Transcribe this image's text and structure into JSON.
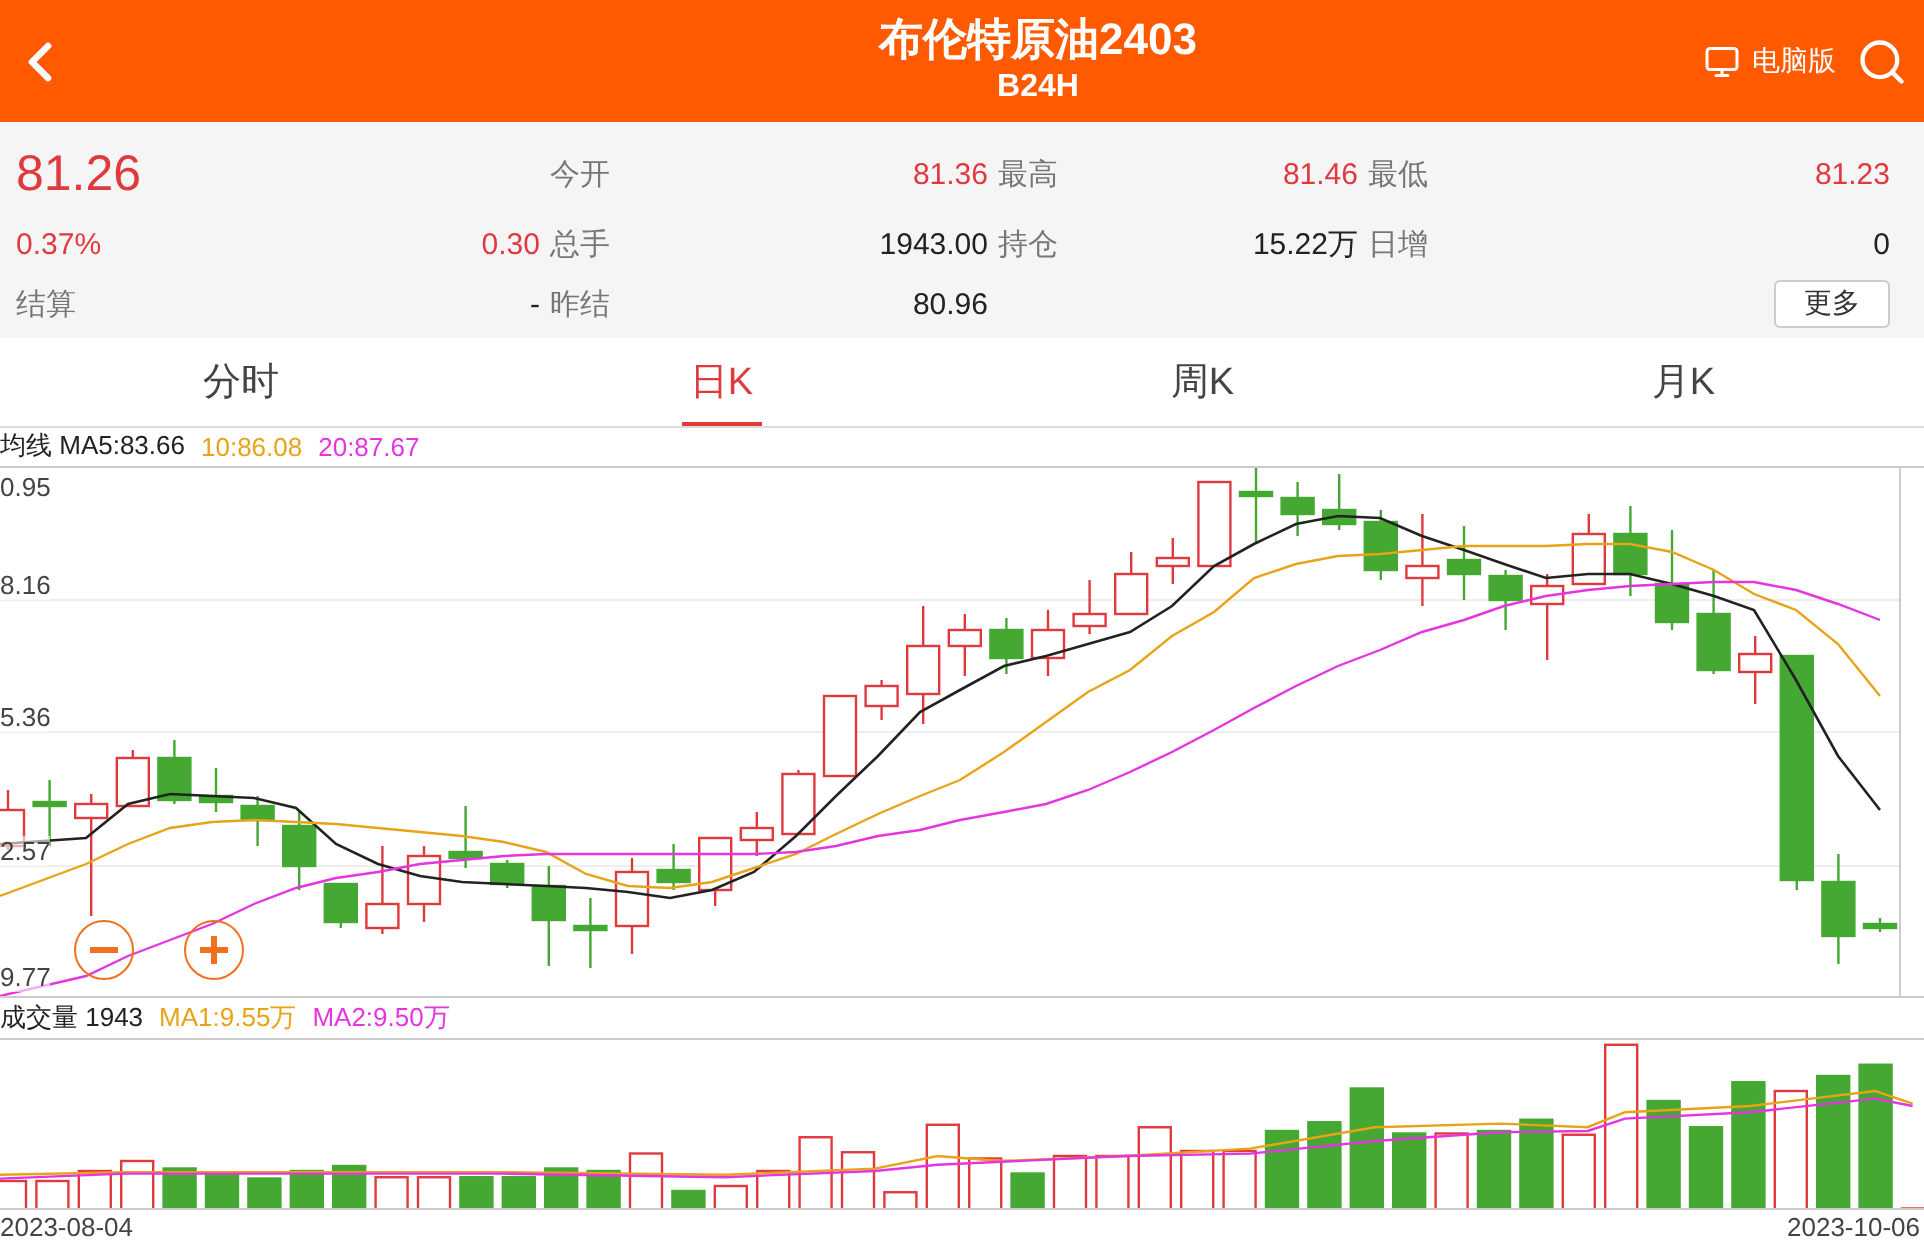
{
  "header": {
    "title": "布伦特原油2403",
    "code": "B24H",
    "desktop_label": "电脑版"
  },
  "quote": {
    "price": "81.26",
    "change_pct": "0.37%",
    "change": "0.30",
    "settle_label": "结算",
    "settle_value": "-",
    "more_button": "更多",
    "rows": [
      [
        {
          "label": "今开",
          "value": "81.36",
          "color": "#e0393e"
        },
        {
          "label": "最高",
          "value": "81.46",
          "color": "#e0393e"
        },
        {
          "label": "最低",
          "value": "81.23",
          "color": "#e0393e"
        }
      ],
      [
        {
          "label": "总手",
          "value": "1943.00",
          "color": "#222222"
        },
        {
          "label": "持仓",
          "value": "15.22万",
          "color": "#222222"
        },
        {
          "label": "日增",
          "value": "0",
          "color": "#222222"
        }
      ],
      [
        {
          "label": "昨结",
          "value": "80.96",
          "color": "#222222"
        }
      ]
    ]
  },
  "tabs": [
    {
      "label": "分时",
      "selected": false
    },
    {
      "label": "日K",
      "selected": true
    },
    {
      "label": "周K",
      "selected": false
    },
    {
      "label": "月K",
      "selected": false
    }
  ],
  "price_chart": {
    "legend": [
      {
        "text": "均线 MA5:83.66",
        "color": "#222222"
      },
      {
        "text": "10:86.08",
        "color": "#e8a317"
      },
      {
        "text": "20:87.67",
        "color": "#e535e0"
      }
    ],
    "y_labels": [
      "0.95",
      "8.16",
      "5.36",
      "2.57",
      "9.77"
    ]
  },
  "volume_chart": {
    "legend": [
      {
        "text": "成交量 1943",
        "color": "#222222"
      },
      {
        "text": "MA1:9.55万",
        "color": "#e8a317"
      },
      {
        "text": "MA2:9.50万",
        "color": "#e535e0"
      }
    ],
    "dates": [
      "2023-08-04",
      "2023-10-06"
    ]
  }
}
